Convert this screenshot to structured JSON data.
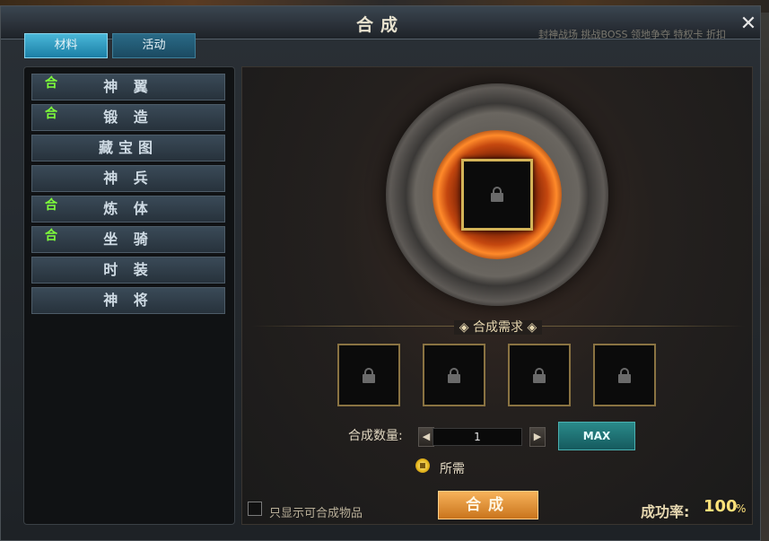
{
  "window": {
    "title": "合成",
    "close_label": "✕"
  },
  "background": {
    "top_links": "封神战场 挑战BOSS 领地争夺 特权卡 折扣"
  },
  "tabs": [
    {
      "label": "材料",
      "active": true
    },
    {
      "label": "活动",
      "active": false
    }
  ],
  "sidebar": {
    "badge": "合",
    "items": [
      {
        "label": "神 翼",
        "badge": true
      },
      {
        "label": "锻 造",
        "badge": true
      },
      {
        "label": "藏宝图",
        "badge": false
      },
      {
        "label": "神 兵",
        "badge": false
      },
      {
        "label": "炼 体",
        "badge": true
      },
      {
        "label": "坐 骑",
        "badge": false
      },
      {
        "label": "时 装",
        "badge": false
      },
      {
        "label": "神 将",
        "badge": false
      }
    ]
  },
  "main": {
    "requirement_label": "◈ 合成需求 ◈",
    "quantity": {
      "label": "合成数量:",
      "value": "1",
      "left_arrow": "◀",
      "right_arrow": "▶"
    },
    "max_label": "MAX",
    "cost_label": "所需",
    "only_show_label": "只显示可合成物品",
    "synth_button_label": "合成",
    "success_rate": {
      "label": "成功率:",
      "value": "100",
      "unit": "%"
    }
  },
  "icons": {
    "close": "close-icon",
    "lock": "lock-icon",
    "coin": "coin-icon"
  },
  "colors": {
    "tab_active": "#2a9ec6",
    "badge_green": "#7fff3a",
    "synth_button": "#e8963a",
    "max_button": "#1f7a7c",
    "rate_value": "#ffe27a",
    "slot_border": "#d4b458"
  }
}
